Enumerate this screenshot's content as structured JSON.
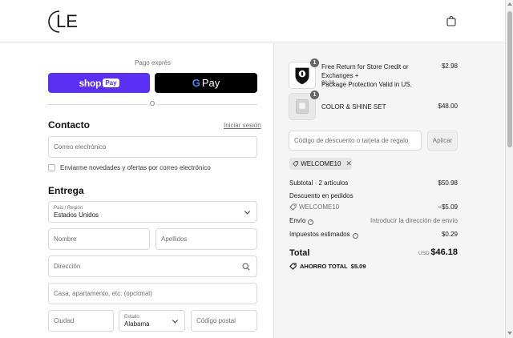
{
  "header": {
    "logo_text": "LE",
    "bag_icon": "shopping-bag-icon"
  },
  "express": {
    "title": "Pago exprés",
    "shop_pay_word": "shop",
    "shop_pay_pill": "Pay",
    "gpay_g": "G",
    "gpay_label": "Pay",
    "separator": "O"
  },
  "contact": {
    "title": "Contacto",
    "login_link": "Iniciar sesión",
    "email_placeholder": "Correo electrónico",
    "newsletter_label": "Enviarme novedades y ofertas por correo electrónico"
  },
  "delivery": {
    "title": "Entrega",
    "country_label": "País / Región",
    "country_value": "Estados Unidos",
    "first_name_placeholder": "Nombre",
    "last_name_placeholder": "Apellidos",
    "address_placeholder": "Dirección",
    "apartment_placeholder": "Casa, apartamento, etc. (opcional)",
    "city_placeholder": "Ciudad",
    "state_label": "Estado",
    "state_value": "Alabama",
    "postal_placeholder": "Código postal"
  },
  "order": {
    "items": [
      {
        "name_line1": "Free Return for Store Credit or Exchanges +",
        "name_line2": "Package Protection Valid in US.",
        "sub": "$2.98",
        "price": "$2.98",
        "qty": "1"
      },
      {
        "name_line1": "COLOR & SHINE SET",
        "name_line2": "",
        "sub": "",
        "price": "$48.00",
        "qty": "1"
      }
    ],
    "discount_placeholder": "Código de descuento o tarjeta de regalo",
    "apply_label": "Aplicar",
    "applied_code": "WELCOME10",
    "subtotal_label": "Subtotal · 2 artículos",
    "subtotal_value": "$50.98",
    "order_discount_label": "Descuento en pedidos",
    "discount_code": "WELCOME10",
    "discount_value": "−$5.09",
    "shipping_label": "Envío",
    "shipping_value": "Introducir la dirección de envío",
    "taxes_label": "Impuestos estimados",
    "taxes_value": "$0.29",
    "total_label": "Total",
    "total_currency": "USD",
    "total_value": "$46.18",
    "saving_label": "AHORRO TOTAL",
    "saving_value": "$5.09"
  }
}
